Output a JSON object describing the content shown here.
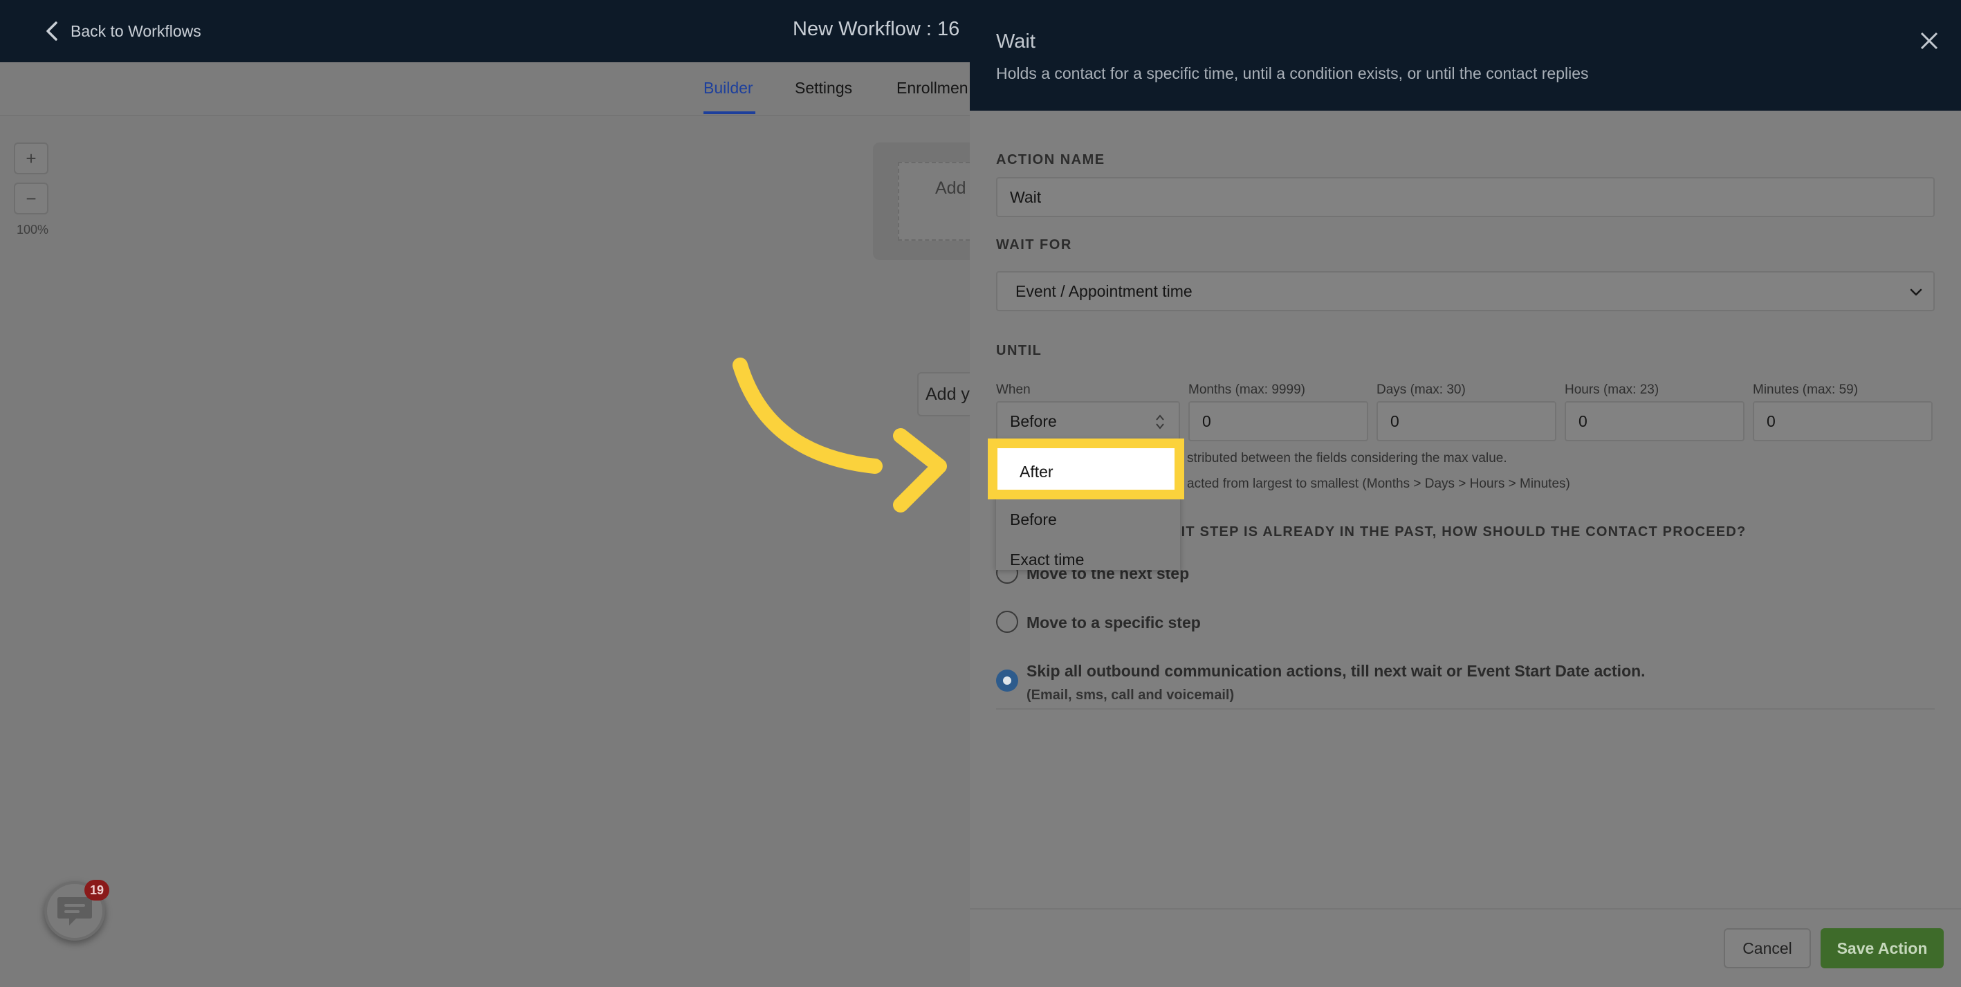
{
  "header": {
    "back_label": "Back to Workflows",
    "workflow_title": "New Workflow : 16"
  },
  "tabs": [
    {
      "label": "Builder",
      "active": true
    },
    {
      "label": "Settings",
      "active": false
    },
    {
      "label": "Enrollmen",
      "active": false
    }
  ],
  "canvas": {
    "zoom_in": "+",
    "zoom_out": "−",
    "zoom_level": "100%",
    "node_text": "Add",
    "add_text": "Add y"
  },
  "chat": {
    "badge_count": "19"
  },
  "drawer": {
    "title": "Wait",
    "subtitle": "Holds a contact for a specific time, until a condition exists, or until the contact replies",
    "action_name_label": "ACTION NAME",
    "action_name_value": "Wait",
    "wait_for_label": "WAIT FOR",
    "wait_for_value": "Event / Appointment time",
    "until_label": "UNTIL",
    "when_label": "When",
    "when_value": "Before",
    "months_label": "Months (max: 9999)",
    "months_value": "0",
    "days_label": "Days (max: 30)",
    "days_value": "0",
    "hours_label": "Hours (max: 23)",
    "hours_value": "0",
    "minutes_label": "Minutes (max: 59)",
    "minutes_value": "0",
    "hint1": "stributed between the fields considering the max value.",
    "hint2": "acted from largest to smallest (Months > Days > Hours > Minutes)",
    "question": "AIT STEP IS ALREADY IN THE PAST, HOW SHOULD THE CONTACT PROCEED?",
    "option1": "Move to the next step",
    "option2": "Move to a specific step",
    "option3": "Skip all outbound communication actions, till next wait or Event Start Date action.",
    "option3_sub": "(Email, sms, call and voicemail)",
    "cancel_label": "Cancel",
    "save_label": "Save Action"
  },
  "dropdown": {
    "options": [
      "After",
      "Before",
      "Exact time"
    ],
    "highlighted": "After"
  },
  "colors": {
    "accent_highlight": "#fbd23c",
    "save_button": "#3e6b2a",
    "header_bg": "#0d1a28"
  }
}
